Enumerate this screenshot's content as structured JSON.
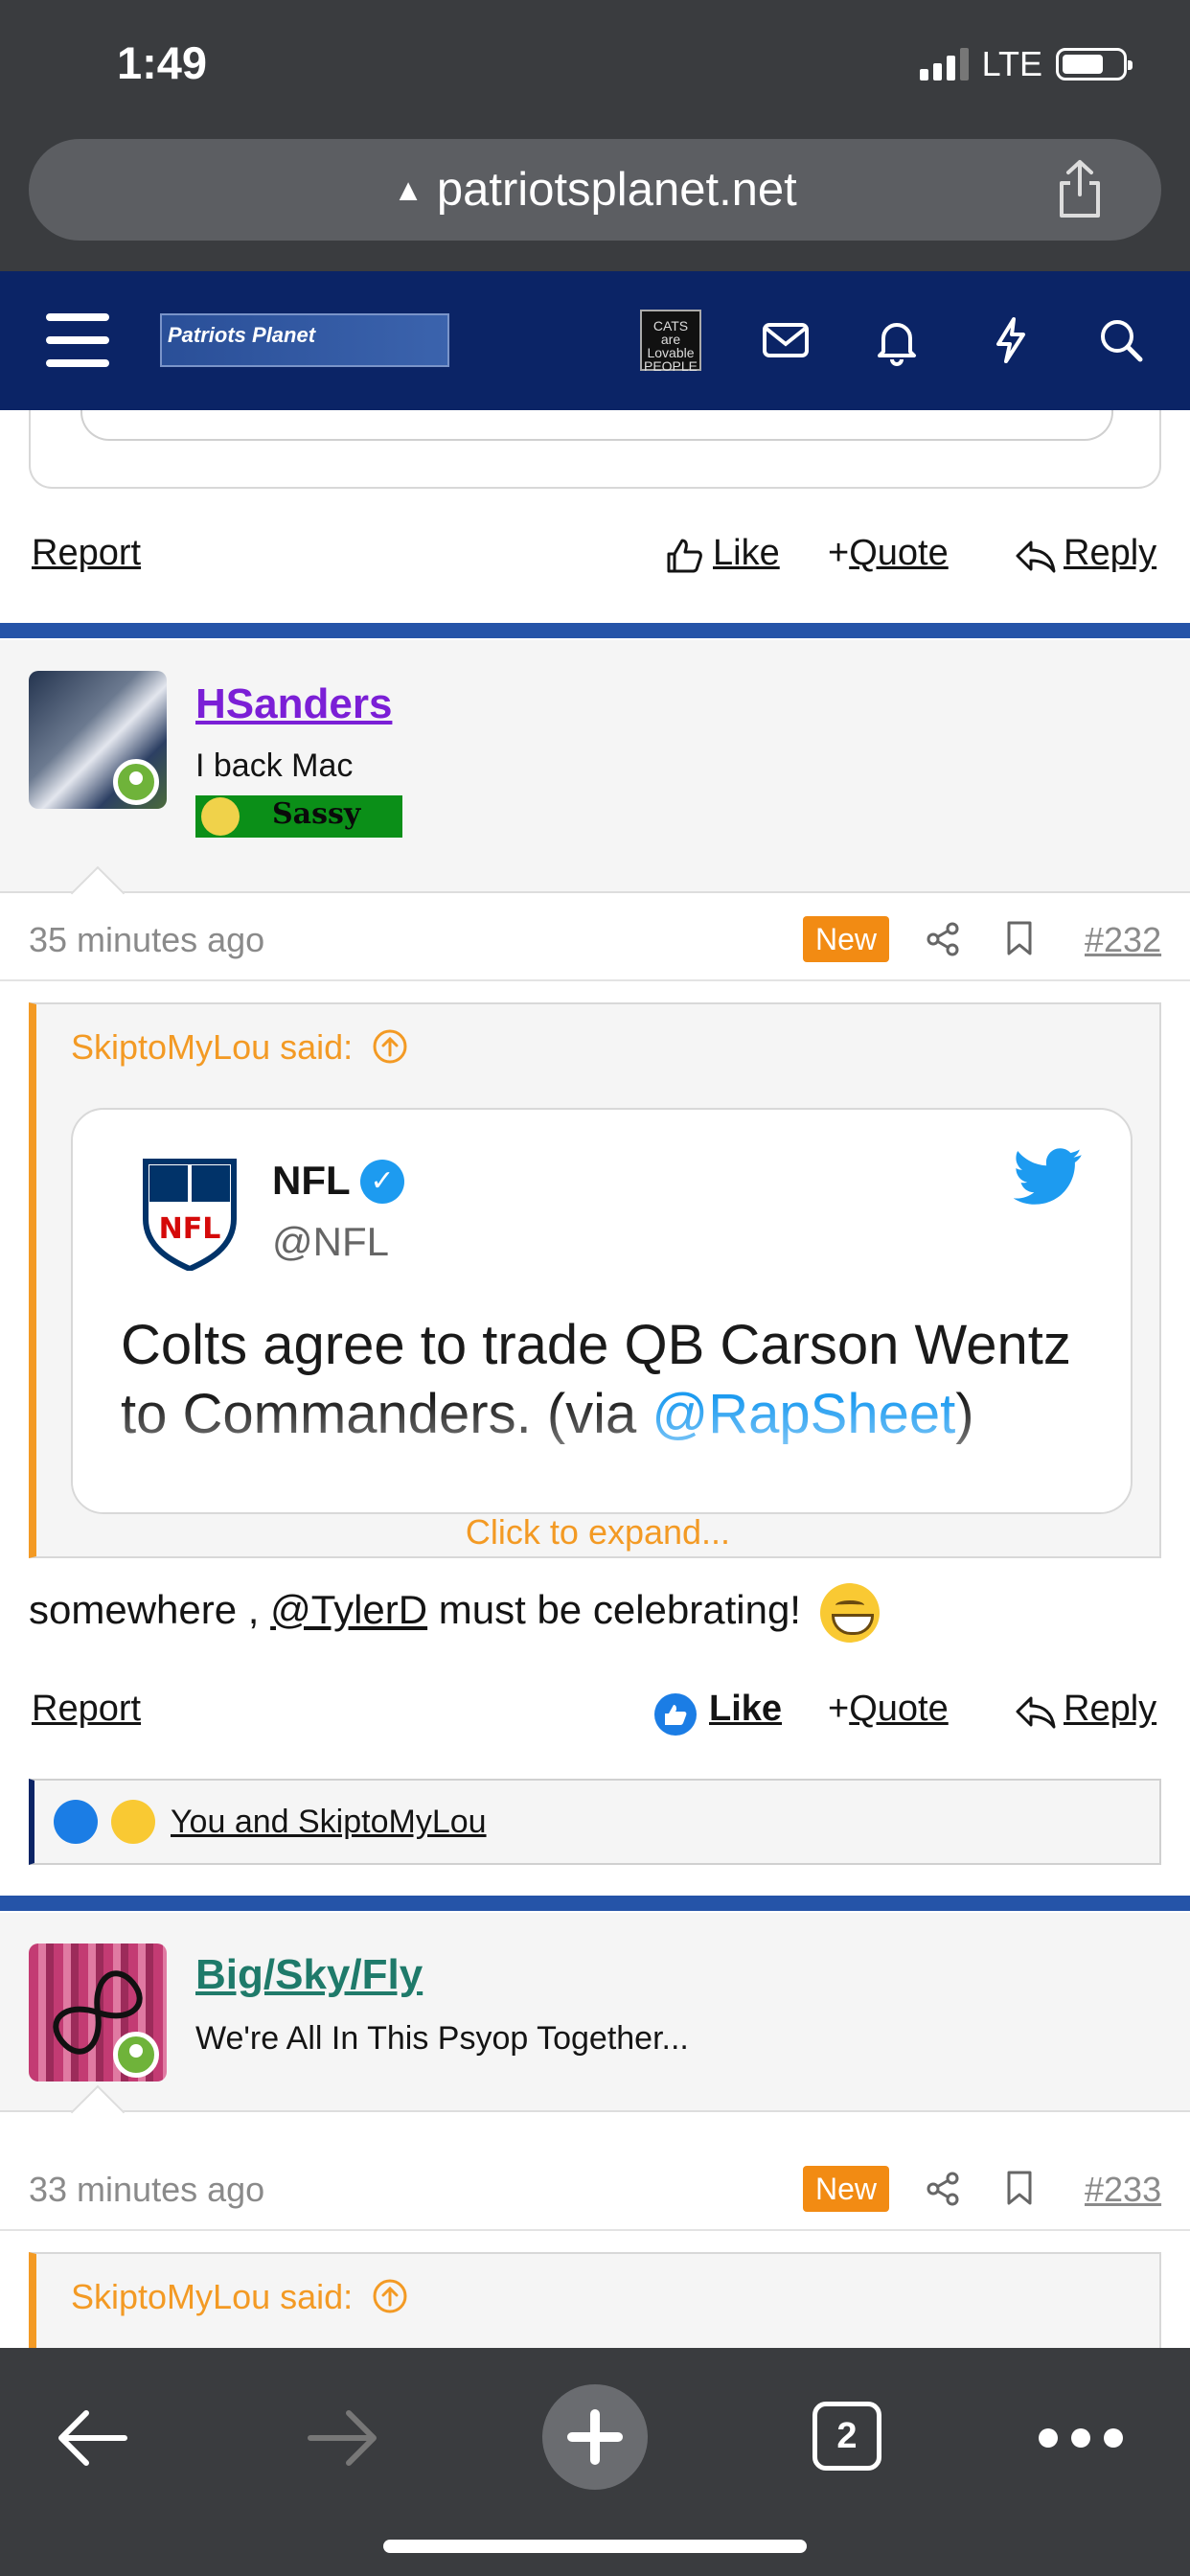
{
  "status_bar": {
    "time": "1:49",
    "network": "LTE"
  },
  "browser": {
    "url": "patriotsplanet.net"
  },
  "forum": {
    "logo_text": "Patriots Planet",
    "avatar_text": "CATS are Lovable PEOPLE"
  },
  "actions": {
    "report": "Report",
    "like": "Like",
    "quote": "Quote",
    "reply": "Reply"
  },
  "posts": [
    {
      "username": "HSanders",
      "username_color": "#7b1fd6",
      "user_title": "I back Mac",
      "badge": "Sassy",
      "time": "35 minutes ago",
      "new_badge": "New",
      "post_number": "#232",
      "quote": {
        "author_line": "SkiptoMyLou said:",
        "tweet": {
          "name": "NFL",
          "handle": "@NFL",
          "text_main": "Colts agree to trade QB Carson Wentz to Commanders. (via ",
          "text_link": "@RapSheet",
          "text_end": ")"
        },
        "expand": "Click to expand..."
      },
      "body_before": "somewhere , ",
      "body_mention": "@TylerD",
      "body_after": " must be celebrating!",
      "reactions_text": "You and SkiptoMyLou"
    },
    {
      "username": "Big/Sky/Fly",
      "username_color": "#1f7a6a",
      "user_title": "We're All In This Psyop Together...",
      "time": "33 minutes ago",
      "new_badge": "New",
      "post_number": "#233",
      "quote": {
        "author_line": "SkiptoMyLou said:"
      }
    }
  ],
  "toolbar": {
    "tab_count": "2"
  },
  "colors": {
    "accent": "#f39a24",
    "header": "#0b2466",
    "divider": "#2554a8",
    "new_badge": "#f28b13"
  }
}
